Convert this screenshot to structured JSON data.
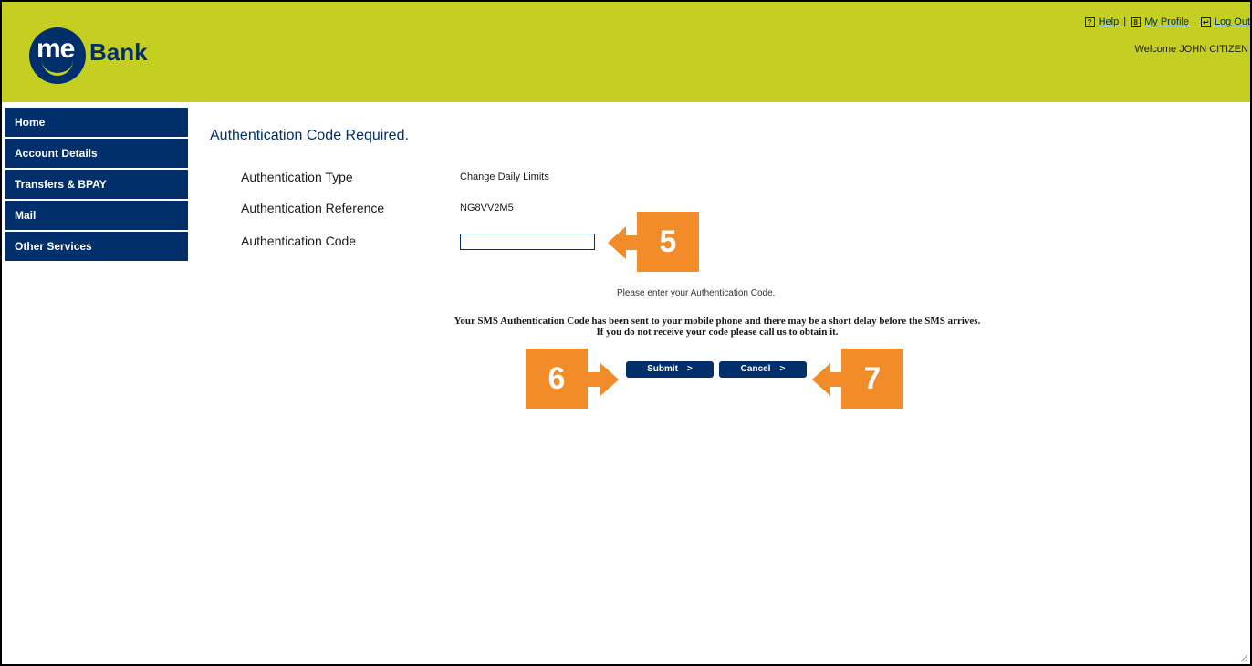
{
  "brand": {
    "logo_text_me": "me",
    "logo_text_bank": "Bank",
    "primary": "#002f6c",
    "header_bg": "#c4cf22",
    "callout": "#f28c28"
  },
  "toplinks": {
    "help": "Help",
    "profile": "My Profile",
    "logout": "Log Out",
    "welcome": "Welcome JOHN CITIZEN"
  },
  "sidebar": {
    "items": [
      {
        "label": "Home"
      },
      {
        "label": "Account Details"
      },
      {
        "label": "Transfers & BPAY"
      },
      {
        "label": "Mail"
      },
      {
        "label": "Other Services"
      }
    ]
  },
  "page": {
    "title": "Authentication Code Required.",
    "auth_type_label": "Authentication Type",
    "auth_type_value": "Change Daily Limits",
    "auth_ref_label": "Authentication Reference",
    "auth_ref_value": "NG8VV2M5",
    "auth_code_label": "Authentication Code",
    "auth_code_value": "",
    "prompt": "Please enter your Authentication Code.",
    "sms_line1": "Your SMS Authentication Code has been sent to your mobile phone and there may be a short delay before the SMS arrives.",
    "sms_line2": "If you do not receive your code please call us to obtain it.",
    "submit_label": "Submit",
    "cancel_label": "Cancel",
    "button_arrow": ">"
  },
  "callouts": {
    "five": "5",
    "six": "6",
    "seven": "7"
  }
}
